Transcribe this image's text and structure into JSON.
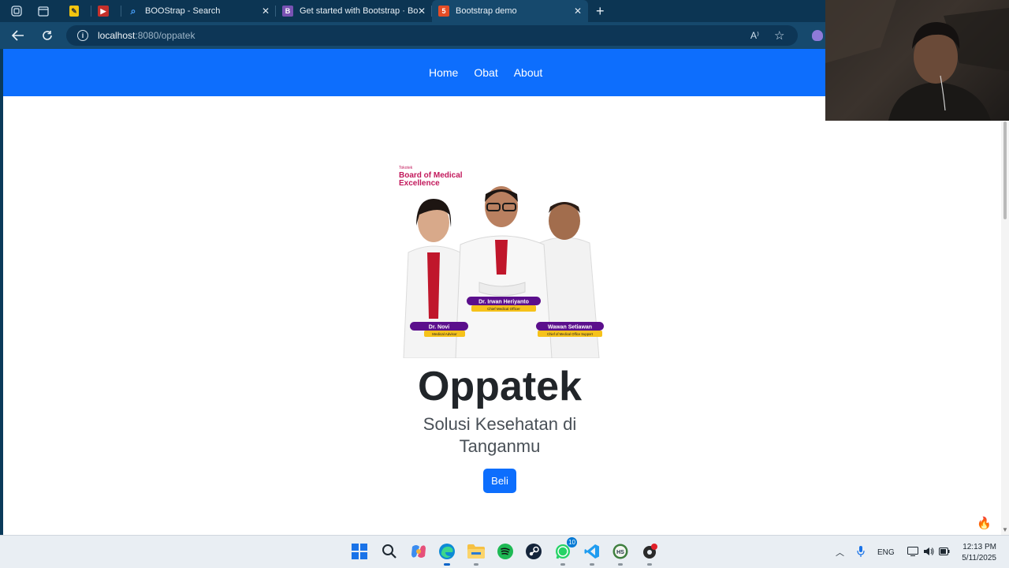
{
  "browser": {
    "tabs": [
      {
        "title": "",
        "favicon": "sticky-note-icon",
        "color": "#f2c40f"
      },
      {
        "title": "",
        "favicon": "youtube-icon",
        "color": "#c4302b"
      },
      {
        "title": "BOOStrap - Search",
        "favicon": "search-icon",
        "color": "#4aa3ff"
      },
      {
        "title": "Get started with Bootstrap · Bootstrap",
        "favicon": "bootstrap-icon",
        "color": "#7952b3"
      },
      {
        "title": "Bootstrap demo",
        "favicon": "html5-icon",
        "color": "#e44d26"
      }
    ],
    "address": {
      "host": "localhost",
      "rest": ":8080/oppatek"
    },
    "read_aloud_glyph": "A⁾",
    "new_tab_glyph": "+"
  },
  "page": {
    "nav": {
      "links": [
        "Home",
        "Obat",
        "About"
      ]
    },
    "hero": {
      "image": {
        "brand_small": "Tokotek",
        "brand_title_1": "Board of Medical",
        "brand_title_2": "Excellence",
        "people": [
          {
            "name": "Dr. Novi",
            "role": "Medical Advisor"
          },
          {
            "name": "Dr. Irwan Heriyanto",
            "role": "Chief Medical Officer"
          },
          {
            "name": "Wawan Setiawan",
            "role": "Chief of Medical Office Support"
          }
        ]
      },
      "title": "Oppatek",
      "subtitle": "Solusi Kesehatan di Tanganmu",
      "cta": "Beli"
    }
  },
  "taskbar": {
    "apps": [
      "start-icon",
      "search-icon",
      "copilot-icon",
      "edge-icon",
      "file-explorer-icon",
      "spotify-icon",
      "steam-icon",
      "whatsapp-icon",
      "vscode-icon",
      "hs-app-icon",
      "notification-app-icon"
    ],
    "whatsapp_badge": "10",
    "hs_label": "HS",
    "tray": {
      "lang": "ENG"
    },
    "time": "12:13 PM",
    "date": "5/11/2025"
  },
  "colors": {
    "primary": "#0d6efd",
    "chrome": "#16496d",
    "magenta": "#c2185b",
    "purple": "#5b0f8c"
  }
}
